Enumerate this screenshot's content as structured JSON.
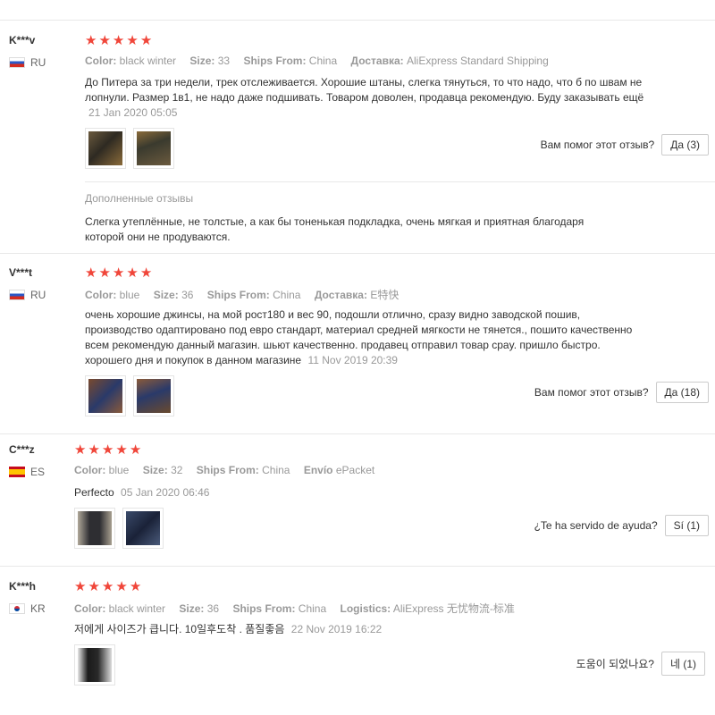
{
  "colors": {
    "star": "#f0463a",
    "muted": "#999999",
    "divider": "#e8e8e8"
  },
  "reviews": [
    {
      "user": "K***v",
      "country": "RU",
      "flag": "flag-ru",
      "stars": 5,
      "attrs": [
        {
          "key": "Color:",
          "value": "black winter"
        },
        {
          "key": "Size:",
          "value": "33"
        },
        {
          "key": "Ships From:",
          "value": "China"
        },
        {
          "key": "Доставка:",
          "value": "AliExpress Standard Shipping"
        }
      ],
      "text_lines": [
        "До Питера за три недели, трек отслеживается. Хорошие штаны, слегка тянуться, то что надо, что б по швам не",
        "лопнули. Размер 1в1, не надо даже подшивать. Товаром доволен, продавца рекомендую. Буду заказывать ещё"
      ],
      "date": "21 Jan 2020 05:05",
      "helpful_question": "Вам помог этот отзыв?",
      "helpful_button": "Да (3)",
      "additional_title": "Дополненные отзывы",
      "additional_lines": [
        "Слегка утеплённые, не толстые, а как бы тоненькая подкладка, очень мягкая и приятная благодаря",
        "которой они не продуваются."
      ]
    },
    {
      "user": "V***t",
      "country": "RU",
      "flag": "flag-ru",
      "stars": 5,
      "attrs": [
        {
          "key": "Color:",
          "value": "blue"
        },
        {
          "key": "Size:",
          "value": "36"
        },
        {
          "key": "Ships From:",
          "value": "China"
        },
        {
          "key": "Доставка:",
          "value": "E特快"
        }
      ],
      "text_lines": [
        "очень хорошие джинсы, на мой рост180 и вес 90, подошли отлично, сразу видно заводской пошив,",
        "производство одаптировано под евро стандарт, материал средней мягкости не тянется., пошито качественно",
        "всем рекомендую данный магазин. шьют качественно. продавец отправил товар сраy. пришло быстро.",
        "хорошего дня и покупок в данном магазине"
      ],
      "date": "11 Nov 2019 20:39",
      "helpful_question": "Вам помог этот отзыв?",
      "helpful_button": "Да (18)"
    },
    {
      "user": "C***z",
      "country": "ES",
      "flag": "flag-es",
      "stars": 5,
      "attrs": [
        {
          "key": "Color:",
          "value": "blue"
        },
        {
          "key": "Size:",
          "value": "32"
        },
        {
          "key": "Ships From:",
          "value": "China"
        },
        {
          "key": "Envío",
          "value": "ePacket"
        }
      ],
      "text_lines": [
        "Perfecto"
      ],
      "date": "05 Jan 2020 06:46",
      "helpful_question": "¿Te ha servido de ayuda?",
      "helpful_button": "Sí (1)"
    },
    {
      "user": "K***h",
      "country": "KR",
      "flag": "flag-kr",
      "stars": 5,
      "attrs": [
        {
          "key": "Color:",
          "value": "black winter"
        },
        {
          "key": "Size:",
          "value": "36"
        },
        {
          "key": "Ships From:",
          "value": "China"
        },
        {
          "key": "Logistics:",
          "value": "AliExpress 无忧物流-标准"
        }
      ],
      "text_lines": [
        "저에게 사이즈가 큽니다. 10일후도착 . 품질좋음"
      ],
      "date": "22 Nov 2019 16:22",
      "helpful_question": "도움이 되었나요?",
      "helpful_button": "네 (1)"
    }
  ]
}
